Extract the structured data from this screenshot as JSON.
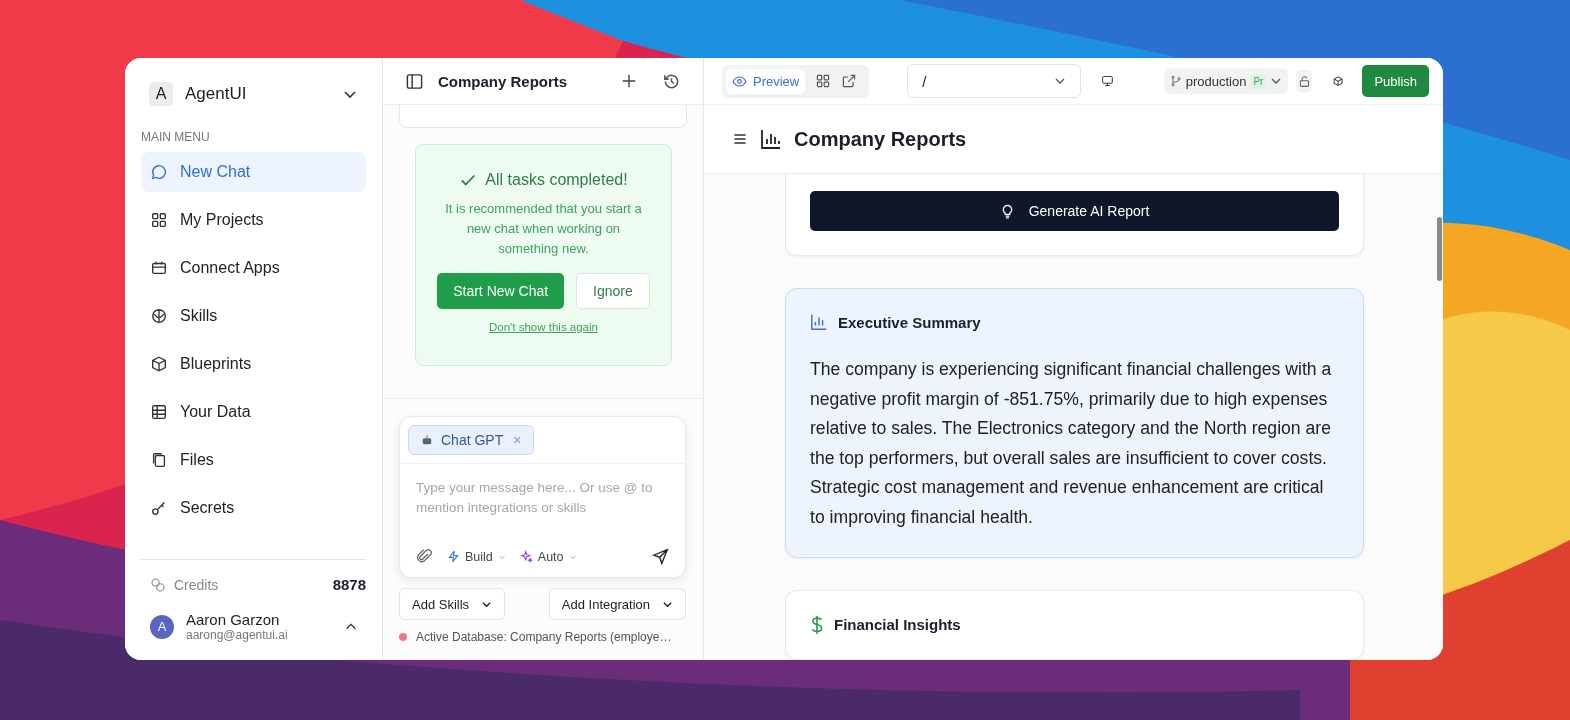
{
  "sidebar": {
    "workspace": {
      "initial": "A",
      "name": "AgentUI"
    },
    "section_label": "MAIN MENU",
    "items": [
      {
        "label": "New Chat",
        "selected": true
      },
      {
        "label": "My Projects",
        "selected": false
      },
      {
        "label": "Connect Apps",
        "selected": false
      },
      {
        "label": "Skills",
        "selected": false
      },
      {
        "label": "Blueprints",
        "selected": false
      },
      {
        "label": "Your Data",
        "selected": false
      },
      {
        "label": "Files",
        "selected": false
      },
      {
        "label": "Secrets",
        "selected": false
      }
    ],
    "credits": {
      "label": "Credits",
      "value": "8878"
    },
    "user": {
      "initial": "A",
      "name": "Aaron Garzon",
      "email": "aarong@agentui.ai"
    }
  },
  "chat_panel": {
    "title": "Company Reports",
    "notice": {
      "title": "All tasks completed!",
      "message": "It is recommended that you start a new chat when working on something new.",
      "primary_button": "Start New Chat",
      "secondary_button": "Ignore",
      "link": "Don't show this again"
    },
    "composer": {
      "chip": "Chat GPT",
      "chip_close": "×",
      "placeholder": "Type your message here... Or use @ to mention integrations or skills",
      "mode": "Build",
      "model_mode": "Auto"
    },
    "add_skills": "Add Skills",
    "add_integration": "Add Integration",
    "active_database": "Active Database: Company Reports (employe…"
  },
  "toolbar": {
    "tabs": [
      {
        "label": "Preview",
        "selected": true
      }
    ],
    "route": "/",
    "branch": "production",
    "branch_badge": "Pr",
    "publish": "Publish"
  },
  "report": {
    "title": "Company Reports",
    "generate_button": "Generate AI Report",
    "sections": [
      {
        "kind": "highlight",
        "title": "Executive Summary",
        "body": "The company is experiencing significant financial challenges with a negative profit margin of -851.75%, primarily due to high expenses relative to sales. The Electronics category and the North region are the top performers, but overall sales are insufficient to cover costs. Strategic cost management and revenue enhancement are critical to improving financial health."
      },
      {
        "kind": "plain",
        "title": "Financial Insights"
      }
    ]
  }
}
